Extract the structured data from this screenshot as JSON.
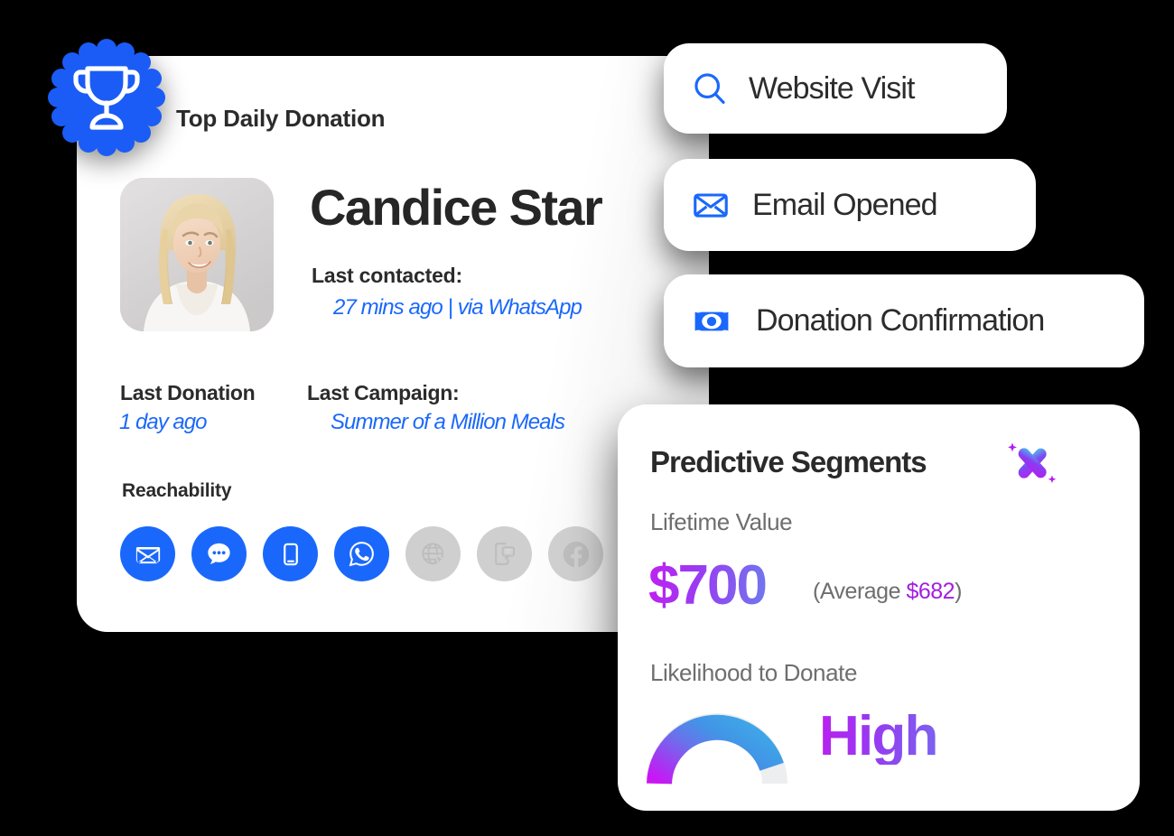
{
  "theme": {
    "background": "#000000",
    "card_bg": "#ffffff",
    "accent_blue": "#1a68fb",
    "text_dark": "#2b2b2b",
    "text_muted": "#6e6e6e",
    "gradient_purple": "#c020f0",
    "gradient_blue": "#6f78ee",
    "inactive_gray": "#cfcfcf"
  },
  "profile_card": {
    "badge_icon": "trophy-icon",
    "title": "Top Daily Donation",
    "avatar_alt": "Candice Star portrait",
    "name": "Candice Star",
    "last_contacted": {
      "label": "Last contacted:",
      "value": "27 mins ago | via WhatsApp"
    },
    "last_donation": {
      "label": "Last Donation",
      "value": "1 day ago"
    },
    "last_campaign": {
      "label": "Last Campaign:",
      "value": "Summer of a Million Meals"
    },
    "reachability": {
      "label": "Reachability",
      "channels": [
        {
          "name": "email",
          "icon": "envelope-icon",
          "active": true
        },
        {
          "name": "chat",
          "icon": "chat-bubble-icon",
          "active": true
        },
        {
          "name": "mobile",
          "icon": "mobile-phone-icon",
          "active": true
        },
        {
          "name": "whatsapp",
          "icon": "whatsapp-icon",
          "active": true
        },
        {
          "name": "web",
          "icon": "globe-cursor-icon",
          "active": false
        },
        {
          "name": "sms",
          "icon": "phone-message-icon",
          "active": false
        },
        {
          "name": "facebook",
          "icon": "facebook-icon",
          "active": false
        }
      ]
    }
  },
  "event_pills": [
    {
      "id": "website",
      "icon": "search-icon",
      "label": "Website Visit"
    },
    {
      "id": "email",
      "icon": "envelope-outline-icon",
      "label": "Email Opened"
    },
    {
      "id": "donation",
      "icon": "banknote-icon",
      "label": "Donation Confirmation"
    }
  ],
  "predictive_segments": {
    "title": "Predictive Segments",
    "icon": "ai-sparkle-icon",
    "lifetime_value": {
      "label": "Lifetime Value",
      "amount": "$700",
      "average_prefix": "(Average ",
      "average_amount": "$682",
      "average_suffix": ")"
    },
    "likelihood": {
      "label": "Likelihood to Donate",
      "value": "High",
      "gauge_fill_percent": 85
    }
  }
}
